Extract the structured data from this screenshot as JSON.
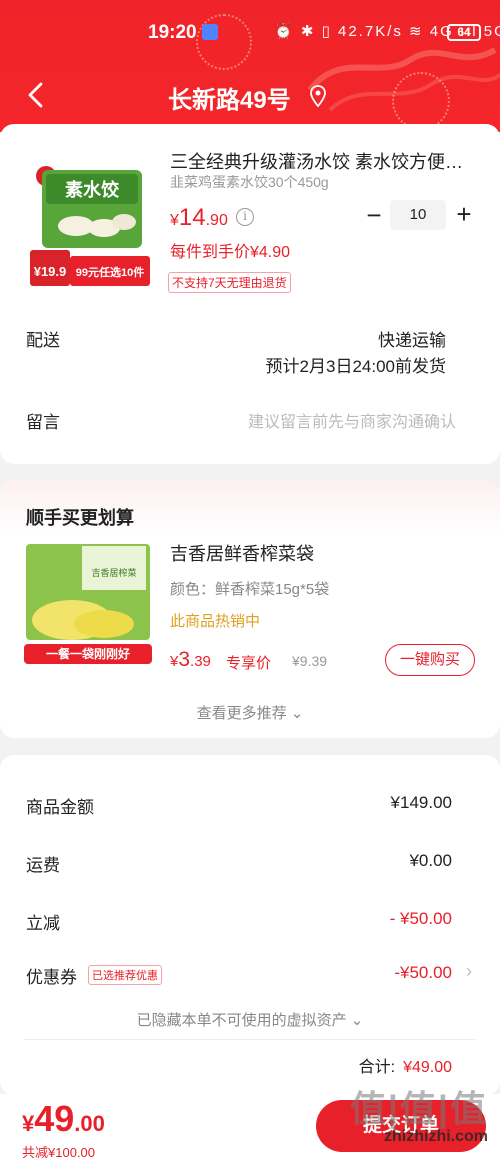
{
  "status_bar": {
    "time": "19:20",
    "icons": "⏰ ✱ ▯ 42.7K/s ≋ 4G ııl 5G ııl",
    "battery": "64"
  },
  "header": {
    "title": "长新路49号"
  },
  "product": {
    "image_badge": "素水饺",
    "image_promo_price": "¥19.9",
    "image_promo_text": "99元任选10件",
    "title": "三全经典升级灌汤水饺 素水饺方便…",
    "spec": "韭菜鸡蛋素水饺30个450g",
    "price_currency": "¥",
    "price_int": "14",
    "price_dec": ".90",
    "quantity": "10",
    "unit_price": "每件到手价¥4.90",
    "return_tag": "不支持7天无理由退货"
  },
  "shipping": {
    "label": "配送",
    "method": "快递运输",
    "date": "预计2月3日24:00前发货"
  },
  "remark": {
    "label": "留言",
    "placeholder": "建议留言前先与商家沟通确认"
  },
  "upsell": {
    "section_title": "顺手买更划算",
    "image_caption": "一餐一袋刚刚好",
    "title": "吉香居鲜香榨菜袋",
    "spec": "颜色：鲜香榨菜15g*5袋",
    "hot": "此商品热销中",
    "price_currency": "¥",
    "price_int": "3",
    "price_dec": ".39",
    "price_tag": "专享价",
    "orig_price": "¥9.39",
    "buy_label": "一键购买",
    "more_label": "查看更多推荐 ⌄"
  },
  "summary": {
    "goods_label": "商品金额",
    "goods_value": "¥149.00",
    "shipping_label": "运费",
    "shipping_value": "¥0.00",
    "discount_label": "立减",
    "discount_value": "- ¥50.00",
    "coupon_label": "优惠券",
    "coupon_tag": "已选推荐优惠",
    "coupon_value": "-¥50.00",
    "hidden_note": "已隐藏本单不可使用的虚拟资产 ⌄",
    "subtotal_label": "合计:",
    "subtotal_value": "¥49.00"
  },
  "bottom": {
    "currency": "¥",
    "int": "49",
    "dec": ".00",
    "saved": "共减¥100.00",
    "submit_label": "提交订单"
  },
  "watermark": {
    "logo": "值|值|值",
    "url": "zhizhizhi.com"
  },
  "colors": {
    "accent": "#e8202a",
    "header": "#f0232a"
  }
}
